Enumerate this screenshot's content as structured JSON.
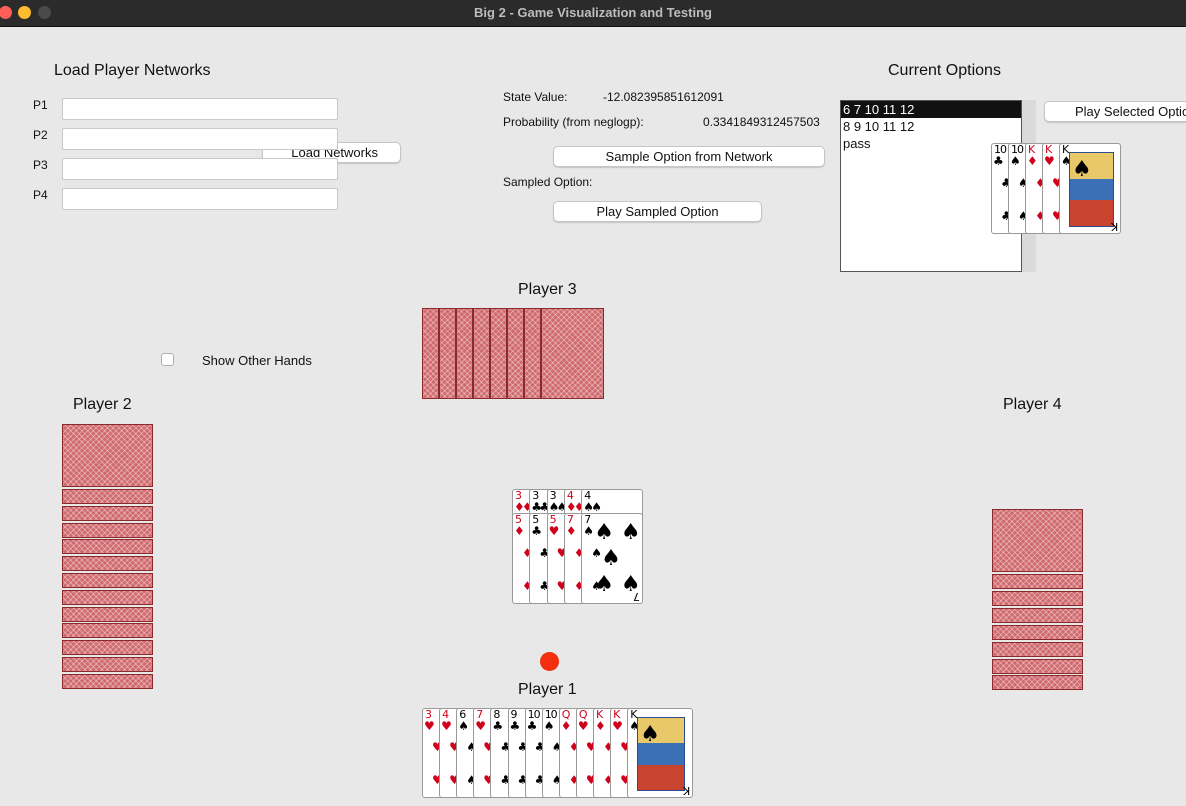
{
  "window": {
    "title": "Big 2 - Game Visualization and Testing"
  },
  "colors": {
    "titlebar": "#2b2b2b",
    "close": "#ff5f57",
    "minimize": "#febc2e",
    "zoom": "#4a4a4a",
    "card_back": "#d06a6e",
    "turn_indicator": "#f2300f"
  },
  "networks": {
    "heading": "Load Player Networks",
    "fields": [
      {
        "label": "P1",
        "value": ""
      },
      {
        "label": "P2",
        "value": ""
      },
      {
        "label": "P3",
        "value": ""
      },
      {
        "label": "P4",
        "value": ""
      }
    ],
    "load_button": "Load Networks"
  },
  "evaluation": {
    "state_value_label": "State Value:",
    "state_value": "-12.082395851612091",
    "probability_label": "Probability (from neglogp):",
    "probability": "0.3341849312457503",
    "sample_button": "Sample Option from Network",
    "sampled_option_label": "Sampled Option:",
    "sampled_option": "",
    "play_sampled_button": "Play Sampled Option"
  },
  "options": {
    "heading": "Current Options",
    "items": [
      {
        "label": "6 7 10 11 12",
        "selected": true
      },
      {
        "label": "8 9 10 11 12",
        "selected": false
      },
      {
        "label": "pass",
        "selected": false
      }
    ],
    "play_selected_button": "Play Selected Option"
  },
  "show_other_hands": {
    "label": "Show Other Hands",
    "checked": false
  },
  "players": {
    "p1": {
      "name": "Player 1"
    },
    "p2": {
      "name": "Player 2"
    },
    "p3": {
      "name": "Player 3"
    },
    "p4": {
      "name": "Player 4"
    }
  },
  "hands": {
    "preview": [
      {
        "rank": "10",
        "suit": "♣",
        "color": "black"
      },
      {
        "rank": "10",
        "suit": "♠",
        "color": "black"
      },
      {
        "rank": "K",
        "suit": "♦",
        "color": "red"
      },
      {
        "rank": "K",
        "suit": "♥",
        "color": "red"
      },
      {
        "rank": "K",
        "suit": "♠",
        "color": "black"
      }
    ],
    "player1": [
      {
        "rank": "3",
        "suit": "♥",
        "color": "red"
      },
      {
        "rank": "4",
        "suit": "♥",
        "color": "red"
      },
      {
        "rank": "6",
        "suit": "♠",
        "color": "black"
      },
      {
        "rank": "7",
        "suit": "♥",
        "color": "red"
      },
      {
        "rank": "8",
        "suit": "♣",
        "color": "black"
      },
      {
        "rank": "9",
        "suit": "♣",
        "color": "black"
      },
      {
        "rank": "10",
        "suit": "♣",
        "color": "black"
      },
      {
        "rank": "10",
        "suit": "♠",
        "color": "black"
      },
      {
        "rank": "Q",
        "suit": "♦",
        "color": "red"
      },
      {
        "rank": "Q",
        "suit": "♥",
        "color": "red"
      },
      {
        "rank": "K",
        "suit": "♦",
        "color": "red"
      },
      {
        "rank": "K",
        "suit": "♥",
        "color": "red"
      },
      {
        "rank": "K",
        "suit": "♠",
        "color": "black"
      }
    ],
    "played_top": [
      {
        "rank": "3",
        "suit": "♦",
        "color": "red"
      },
      {
        "rank": "3",
        "suit": "♣",
        "color": "black"
      },
      {
        "rank": "3",
        "suit": "♠",
        "color": "black"
      },
      {
        "rank": "4",
        "suit": "♦",
        "color": "red"
      },
      {
        "rank": "4",
        "suit": "♠",
        "color": "black"
      }
    ],
    "played_bottom": [
      {
        "rank": "5",
        "suit": "♦",
        "color": "red"
      },
      {
        "rank": "5",
        "suit": "♣",
        "color": "black"
      },
      {
        "rank": "5",
        "suit": "♥",
        "color": "red"
      },
      {
        "rank": "7",
        "suit": "♦",
        "color": "red"
      },
      {
        "rank": "7",
        "suit": "♠",
        "color": "black"
      }
    ]
  }
}
